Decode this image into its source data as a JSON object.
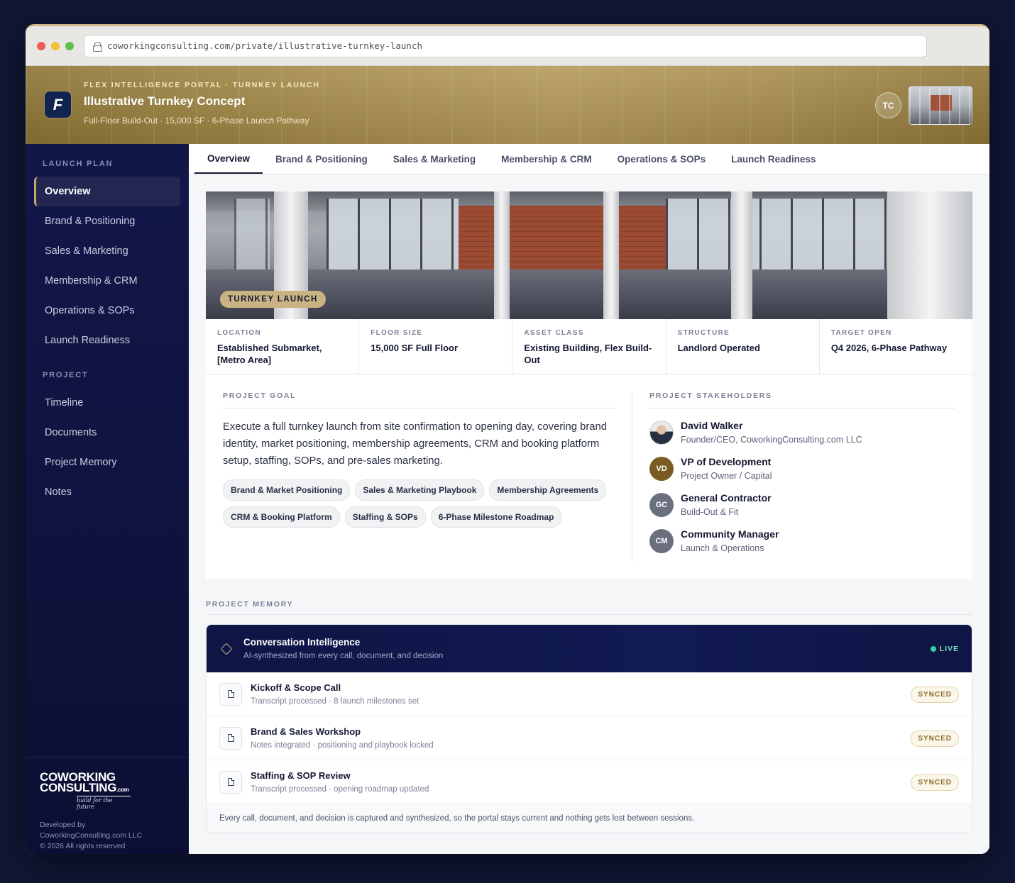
{
  "browser": {
    "url": "coworkingconsulting.com/private/illustrative-turnkey-launch"
  },
  "header": {
    "logo_letter": "F",
    "eyebrow": "FLEX INTELLIGENCE PORTAL · TURNKEY LAUNCH",
    "title": "Illustrative Turnkey Concept",
    "subtitle": "Full-Floor Build-Out · 15,000 SF · 6-Phase Launch Pathway",
    "user_initials": "TC"
  },
  "sidebar": {
    "launch_heading": "LAUNCH PLAN",
    "launch_items": [
      "Overview",
      "Brand & Positioning",
      "Sales & Marketing",
      "Membership & CRM",
      "Operations & SOPs",
      "Launch Readiness"
    ],
    "project_heading": "PROJECT",
    "project_items": [
      "Timeline",
      "Documents",
      "Project Memory",
      "Notes"
    ],
    "brand_line1": "COWORKING",
    "brand_line2": "CONSULTING",
    "brand_com": ".com",
    "brand_tagline": "build for the future",
    "dev_line1": "Developed by",
    "dev_line2": "CoworkingConsulting.com LLC",
    "dev_line3": "© 2026 All rights reserved"
  },
  "tabs": [
    "Overview",
    "Brand & Positioning",
    "Sales & Marketing",
    "Membership & CRM",
    "Operations & SOPs",
    "Launch Readiness"
  ],
  "hero_badge": "TURNKEY LAUNCH",
  "facts": [
    {
      "label": "LOCATION",
      "value": "Established Submarket, [Metro Area]"
    },
    {
      "label": "FLOOR SIZE",
      "value": "15,000 SF Full Floor"
    },
    {
      "label": "ASSET CLASS",
      "value": "Existing Building, Flex Build-Out"
    },
    {
      "label": "STRUCTURE",
      "value": "Landlord Operated"
    },
    {
      "label": "TARGET OPEN",
      "value": "Q4 2026, 6-Phase Pathway"
    }
  ],
  "goal": {
    "heading": "PROJECT GOAL",
    "text": "Execute a full turnkey launch from site confirmation to opening day, covering brand identity, market positioning, membership agreements, CRM and booking platform setup, staffing, SOPs, and pre-sales marketing.",
    "chips": [
      "Brand & Market Positioning",
      "Sales & Marketing Playbook",
      "Membership Agreements",
      "CRM & Booking Platform",
      "Staffing & SOPs",
      "6-Phase Milestone Roadmap"
    ]
  },
  "stakeholders": {
    "heading": "PROJECT STAKEHOLDERS",
    "people": [
      {
        "initials": "",
        "name": "David Walker",
        "role": "Founder/CEO, CoworkingConsulting.com LLC"
      },
      {
        "initials": "VD",
        "name": "VP of Development",
        "role": "Project Owner / Capital"
      },
      {
        "initials": "GC",
        "name": "General Contractor",
        "role": "Build-Out & Fit"
      },
      {
        "initials": "CM",
        "name": "Community Manager",
        "role": "Launch & Operations"
      }
    ]
  },
  "memory": {
    "heading": "PROJECT MEMORY",
    "title": "Conversation Intelligence",
    "subtitle": "AI-synthesized from every call, document, and decision",
    "live": "LIVE",
    "rows": [
      {
        "title": "Kickoff & Scope Call",
        "sub": "Transcript processed · 8 launch milestones set",
        "status": "SYNCED"
      },
      {
        "title": "Brand & Sales Workshop",
        "sub": "Notes integrated · positioning and playbook locked",
        "status": "SYNCED"
      },
      {
        "title": "Staffing & SOP Review",
        "sub": "Transcript processed · opening roadmap updated",
        "status": "SYNCED"
      }
    ],
    "footer": "Every call, document, and decision is captured and synthesized, so the portal stays current and nothing gets lost between sessions."
  }
}
